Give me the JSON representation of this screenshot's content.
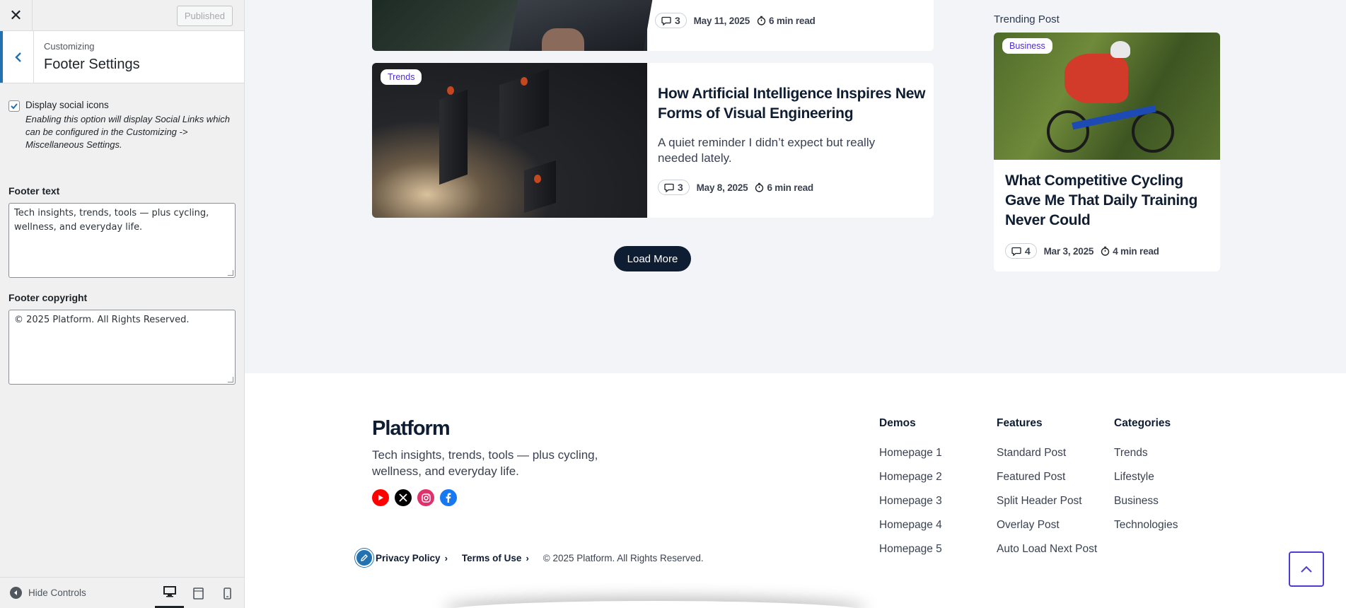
{
  "sidebar": {
    "publish_label": "Published",
    "customizing_label": "Customizing",
    "section_title": "Footer Settings",
    "social": {
      "label": "Display social icons",
      "checked": true,
      "description": "Enabling this option will display Social Links which can be configured in the Customizing -> Miscellaneous Settings."
    },
    "footer_text": {
      "label": "Footer text",
      "value": "Tech insights, trends, tools — plus cycling, wellness, and everyday life."
    },
    "footer_copyright": {
      "label": "Footer copyright",
      "value": "© 2025 Platform. All Rights Reserved."
    },
    "hide_controls_label": "Hide Controls",
    "devices": [
      "desktop-icon",
      "tablet-icon",
      "mobile-icon"
    ]
  },
  "posts": [
    {
      "comments": "3",
      "date": "May 11, 2025",
      "read_time": "6 min read"
    },
    {
      "tag": "Trends",
      "title": "How Artificial Intelligence Inspires New Forms of Visual Engineering",
      "excerpt": "A quiet reminder I didn’t expect but really needed lately.",
      "comments": "3",
      "date": "May 8, 2025",
      "read_time": "6 min read"
    }
  ],
  "load_more_label": "Load More",
  "trending": {
    "heading": "Trending Post",
    "tag": "Business",
    "title": "What Competitive Cycling Gave Me That Daily Training Never Could",
    "comments": "4",
    "date": "Mar 3, 2025",
    "read_time": "4 min read"
  },
  "footer": {
    "logo": "Platform",
    "text": "Tech insights, trends, tools — plus cycling, wellness, and everyday life.",
    "social_icons": [
      "youtube-icon",
      "x-icon",
      "instagram-icon",
      "facebook-icon"
    ],
    "columns": [
      {
        "heading": "Demos",
        "links": [
          "Homepage 1",
          "Homepage 2",
          "Homepage 3",
          "Homepage 4",
          "Homepage 5"
        ]
      },
      {
        "heading": "Features",
        "links": [
          "Standard Post",
          "Featured Post",
          "Split Header Post",
          "Overlay Post",
          "Auto Load Next Post"
        ]
      },
      {
        "heading": "Categories",
        "links": [
          "Trends",
          "Lifestyle",
          "Business",
          "Technologies"
        ]
      }
    ],
    "privacy_label": "Privacy Policy",
    "terms_label": "Terms of Use",
    "copyright": "© 2025 Platform. All Rights Reserved."
  },
  "colors": {
    "primary_dark": "#0f1d33",
    "accent_purple": "#4b2fcf",
    "wp_blue": "#2271b1",
    "youtube": "#ff0000",
    "x": "#000000",
    "instagram": "#e1306c",
    "facebook": "#1877f2"
  }
}
